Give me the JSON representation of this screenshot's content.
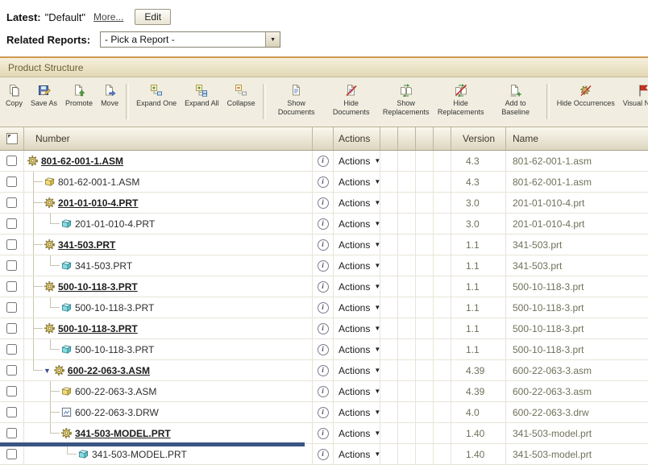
{
  "header": {
    "latest_label": "Latest:",
    "latest_value": "\"Default\"",
    "more_link": "More...",
    "edit_button": "Edit",
    "related_reports_label": "Related Reports:",
    "report_picker_value": "- Pick a Report -"
  },
  "section_title": "Product Structure",
  "toolbar": {
    "items": [
      {
        "label": "Copy",
        "icon": "copy-icon"
      },
      {
        "label": "Save As",
        "icon": "save-as-icon"
      },
      {
        "label": "Promote",
        "icon": "promote-icon"
      },
      {
        "label": "Move",
        "icon": "move-icon"
      },
      {
        "label": "Expand One",
        "icon": "expand-one-icon"
      },
      {
        "label": "Expand All",
        "icon": "expand-all-icon"
      },
      {
        "label": "Collapse",
        "icon": "collapse-icon"
      },
      {
        "label": "Show Documents",
        "icon": "show-documents-icon"
      },
      {
        "label": "Hide Documents",
        "icon": "hide-documents-icon"
      },
      {
        "label": "Show Replacements",
        "icon": "show-replacements-icon"
      },
      {
        "label": "Hide Replacements",
        "icon": "hide-replacements-icon"
      },
      {
        "label": "Add to Baseline",
        "icon": "add-to-baseline-icon"
      },
      {
        "label": "Hide Occurrences",
        "icon": "hide-occurrences-icon",
        "nowrap": true
      },
      {
        "label": "Visual Navig",
        "icon": "visual-navigation-icon",
        "nowrap": true
      }
    ]
  },
  "table": {
    "columns": {
      "number": "Number",
      "actions": "Actions",
      "version": "Version",
      "name": "Name"
    },
    "row_actions_label": "Actions",
    "rows": [
      {
        "number": "801-62-001-1.ASM",
        "version": "4.3",
        "name": "801-62-001-1.asm",
        "icon": "gear",
        "link": true,
        "tree": []
      },
      {
        "number": "801-62-001-1.ASM",
        "version": "4.3",
        "name": "801-62-001-1.asm",
        "icon": "assembly",
        "link": false,
        "tree": [
          "t"
        ]
      },
      {
        "number": "201-01-010-4.PRT",
        "version": "3.0",
        "name": "201-01-010-4.prt",
        "icon": "gear",
        "link": true,
        "tree": [
          "t"
        ]
      },
      {
        "number": "201-01-010-4.PRT",
        "version": "3.0",
        "name": "201-01-010-4.prt",
        "icon": "part",
        "link": false,
        "tree": [
          "v",
          "l"
        ]
      },
      {
        "number": "341-503.PRT",
        "version": "1.1",
        "name": "341-503.prt",
        "icon": "gear",
        "link": true,
        "tree": [
          "t"
        ]
      },
      {
        "number": "341-503.PRT",
        "version": "1.1",
        "name": "341-503.prt",
        "icon": "part",
        "link": false,
        "tree": [
          "v",
          "l"
        ]
      },
      {
        "number": "500-10-118-3.PRT",
        "version": "1.1",
        "name": "500-10-118-3.prt",
        "icon": "gear",
        "link": true,
        "tree": [
          "t"
        ]
      },
      {
        "number": "500-10-118-3.PRT",
        "version": "1.1",
        "name": "500-10-118-3.prt",
        "icon": "part",
        "link": false,
        "tree": [
          "v",
          "l"
        ]
      },
      {
        "number": "500-10-118-3.PRT",
        "version": "1.1",
        "name": "500-10-118-3.prt",
        "icon": "gear",
        "link": true,
        "tree": [
          "t"
        ]
      },
      {
        "number": "500-10-118-3.PRT",
        "version": "1.1",
        "name": "500-10-118-3.prt",
        "icon": "part",
        "link": false,
        "tree": [
          "v",
          "l"
        ]
      },
      {
        "number": "600-22-063-3.ASM",
        "version": "4.39",
        "name": "600-22-063-3.asm",
        "icon": "gear",
        "link": true,
        "tree": [
          "l"
        ],
        "twisty": true
      },
      {
        "number": "600-22-063-3.ASM",
        "version": "4.39",
        "name": "600-22-063-3.asm",
        "icon": "assembly",
        "link": false,
        "tree": [
          ".",
          "t"
        ]
      },
      {
        "number": "600-22-063-3.DRW",
        "version": "4.0",
        "name": "600-22-063-3.drw",
        "icon": "drawing",
        "link": false,
        "tree": [
          ".",
          "t"
        ]
      },
      {
        "number": "341-503-MODEL.PRT",
        "version": "1.40",
        "name": "341-503-model.prt",
        "icon": "gear",
        "link": true,
        "tree": [
          ".",
          "l"
        ]
      },
      {
        "number": "341-503-MODEL.PRT",
        "version": "1.40",
        "name": "341-503-model.prt",
        "icon": "part",
        "link": false,
        "tree": [
          ".",
          ".",
          "l"
        ]
      }
    ]
  }
}
